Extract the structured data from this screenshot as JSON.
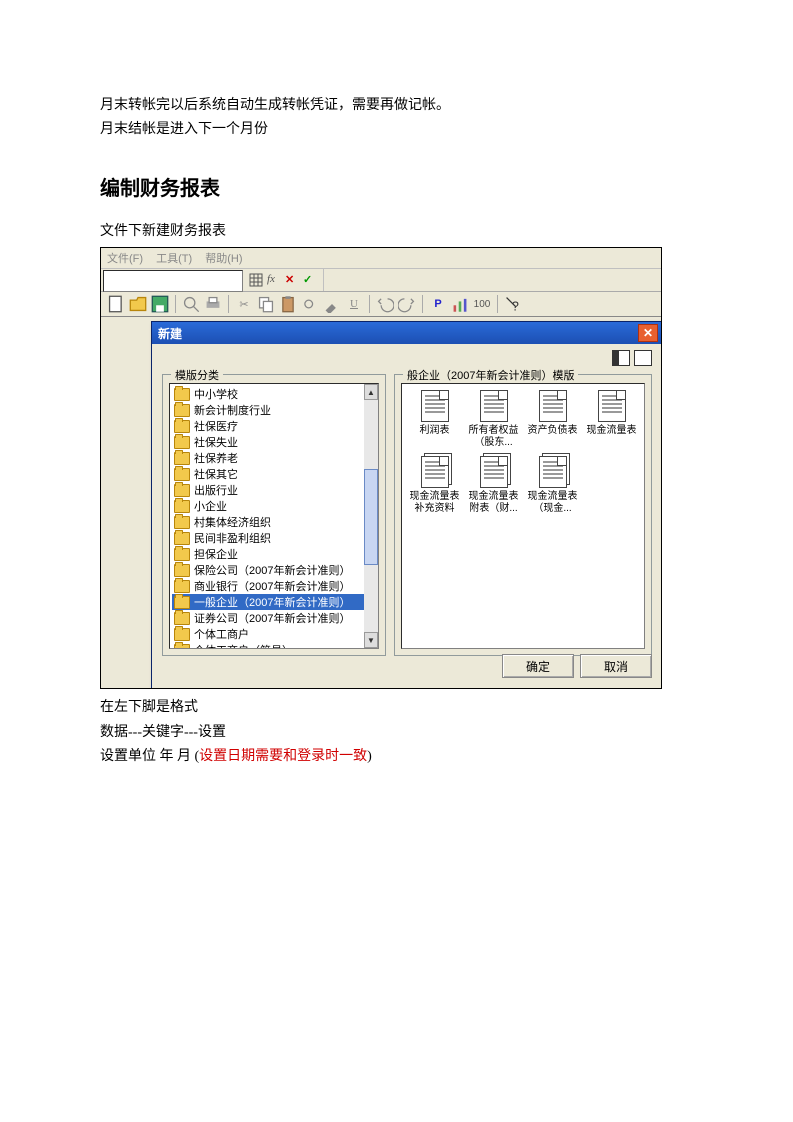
{
  "intro": {
    "line1": "月末转帐完以后系统自动生成转帐凭证，需要再做记帐。",
    "line2": "月末结帐是进入下一个月份"
  },
  "heading": "编制财务报表",
  "caption": "文件下新建财务报表",
  "menubar": {
    "file": "文件(F)",
    "tool": "工具(T)",
    "help": "帮助(H)"
  },
  "toolbar2_labels": {
    "p": "P",
    "hundred": "100",
    "help": "?"
  },
  "dialog": {
    "title": "新建",
    "left_label": "模版分类",
    "right_label": "般企业（2007年新会计准则）模版",
    "categories": [
      "中小学校",
      "新会计制度行业",
      "社保医疗",
      "社保失业",
      "社保养老",
      "社保其它",
      "出版行业",
      "小企业",
      "村集体经济组织",
      "民间非盈利组织",
      "担保企业",
      "保险公司（2007年新会计准则）",
      "商业银行（2007年新会计准则）",
      "一般企业（2007年新会计准则）",
      "证券公司（2007年新会计准则）",
      "个体工商户",
      "个体工商户（简易）"
    ],
    "selected_index": 13,
    "templates": [
      {
        "name": "利润表",
        "double": false
      },
      {
        "name": "所有者权益（股东...",
        "double": false
      },
      {
        "name": "资产负债表",
        "double": false
      },
      {
        "name": "现金流量表",
        "double": false
      },
      {
        "name": "现金流量表补充资料",
        "double": true
      },
      {
        "name": "现金流量表附表（财...",
        "double": true
      },
      {
        "name": "现金流量表（现金...",
        "double": true
      }
    ],
    "ok": "确定",
    "cancel": "取消"
  },
  "after": {
    "l1": "在左下脚是格式",
    "l2": "数据---关键字---设置",
    "l3a": "设置单位  年  月  (",
    "l3b": "设置日期需要和登录时一致",
    "l3c": ")"
  }
}
